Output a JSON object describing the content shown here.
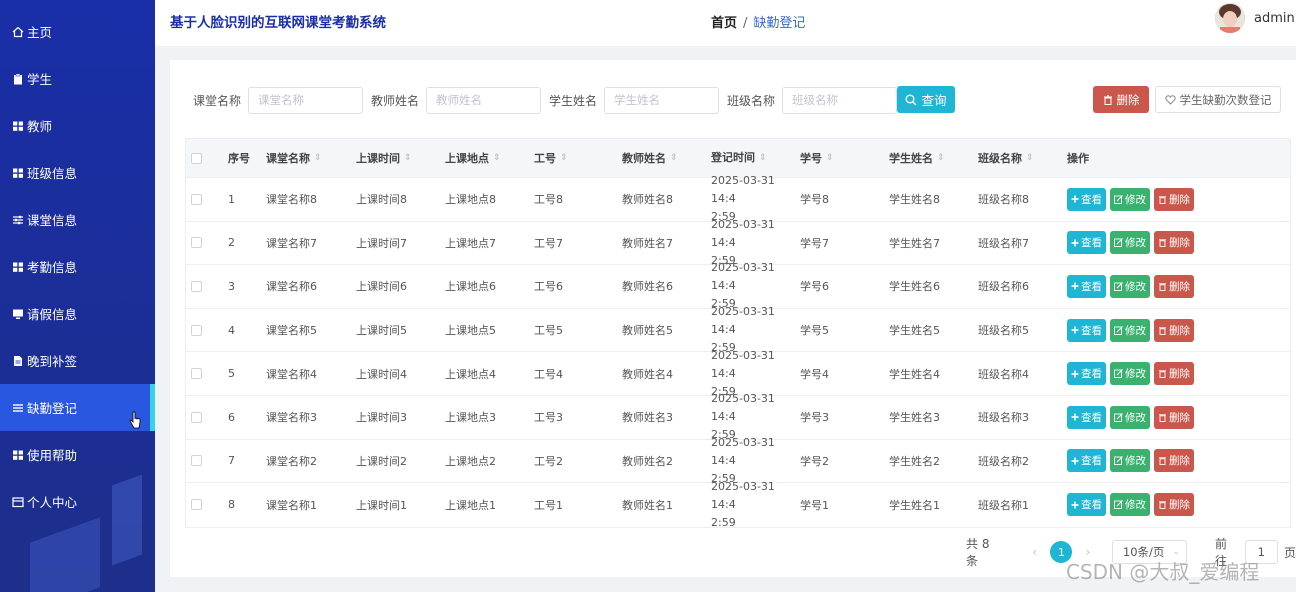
{
  "sidebar": {
    "items": [
      {
        "label": "主页",
        "icon": "home-icon"
      },
      {
        "label": "学生",
        "icon": "clipboard-icon"
      },
      {
        "label": "教师",
        "icon": "grid-icon"
      },
      {
        "label": "班级信息",
        "icon": "grid-icon"
      },
      {
        "label": "课堂信息",
        "icon": "sliders-icon"
      },
      {
        "label": "考勤信息",
        "icon": "grid-icon"
      },
      {
        "label": "请假信息",
        "icon": "monitor-icon"
      },
      {
        "label": "晚到补签",
        "icon": "document-icon"
      },
      {
        "label": "缺勤登记",
        "icon": "list-icon",
        "active": true
      },
      {
        "label": "使用帮助",
        "icon": "grid-icon"
      },
      {
        "label": "个人中心",
        "icon": "window-icon"
      }
    ],
    "active_color": "#2a57e0",
    "accent_color": "#3ad0f0"
  },
  "header": {
    "title": "基于人脸识别的互联网课堂考勤系统",
    "breadcrumb_home": "首页",
    "breadcrumb_sep": "/",
    "breadcrumb_current": "缺勤登记",
    "username": "admin"
  },
  "search": {
    "course_label": "课堂名称",
    "course_placeholder": "课堂名称",
    "teacher_label": "教师姓名",
    "teacher_placeholder": "教师姓名",
    "student_label": "学生姓名",
    "student_placeholder": "学生姓名",
    "class_label": "班级名称",
    "class_placeholder": "班级名称",
    "search_button": "查询",
    "delete_button": "删除",
    "count_button": "学生缺勤次数登记"
  },
  "table": {
    "headers": [
      "序号",
      "课堂名称",
      "上课时间",
      "上课地点",
      "工号",
      "教师姓名",
      "登记时间",
      "学号",
      "学生姓名",
      "班级名称",
      "操作"
    ],
    "rows": [
      {
        "idx": "1",
        "name": "课堂名称8",
        "time": "上课时间8",
        "place": "上课地点8",
        "gh": "工号8",
        "tname": "教师姓名8",
        "reg": "2025-03-31 14:4\n2:59",
        "xh": "学号8",
        "sname": "学生姓名8",
        "bj": "班级名称8"
      },
      {
        "idx": "2",
        "name": "课堂名称7",
        "time": "上课时间7",
        "place": "上课地点7",
        "gh": "工号7",
        "tname": "教师姓名7",
        "reg": "2025-03-31 14:4\n2:59",
        "xh": "学号7",
        "sname": "学生姓名7",
        "bj": "班级名称7"
      },
      {
        "idx": "3",
        "name": "课堂名称6",
        "time": "上课时间6",
        "place": "上课地点6",
        "gh": "工号6",
        "tname": "教师姓名6",
        "reg": "2025-03-31 14:4\n2:59",
        "xh": "学号6",
        "sname": "学生姓名6",
        "bj": "班级名称6"
      },
      {
        "idx": "4",
        "name": "课堂名称5",
        "time": "上课时间5",
        "place": "上课地点5",
        "gh": "工号5",
        "tname": "教师姓名5",
        "reg": "2025-03-31 14:4\n2:59",
        "xh": "学号5",
        "sname": "学生姓名5",
        "bj": "班级名称5"
      },
      {
        "idx": "5",
        "name": "课堂名称4",
        "time": "上课时间4",
        "place": "上课地点4",
        "gh": "工号4",
        "tname": "教师姓名4",
        "reg": "2025-03-31 14:4\n2:59",
        "xh": "学号4",
        "sname": "学生姓名4",
        "bj": "班级名称4"
      },
      {
        "idx": "6",
        "name": "课堂名称3",
        "time": "上课时间3",
        "place": "上课地点3",
        "gh": "工号3",
        "tname": "教师姓名3",
        "reg": "2025-03-31 14:4\n2:59",
        "xh": "学号3",
        "sname": "学生姓名3",
        "bj": "班级名称3"
      },
      {
        "idx": "7",
        "name": "课堂名称2",
        "time": "上课时间2",
        "place": "上课地点2",
        "gh": "工号2",
        "tname": "教师姓名2",
        "reg": "2025-03-31 14:4\n2:59",
        "xh": "学号2",
        "sname": "学生姓名2",
        "bj": "班级名称2"
      },
      {
        "idx": "8",
        "name": "课堂名称1",
        "time": "上课时间1",
        "place": "上课地点1",
        "gh": "工号1",
        "tname": "教师姓名1",
        "reg": "2025-03-31 14:4\n2:59",
        "xh": "学号1",
        "sname": "学生姓名1",
        "bj": "班级名称1"
      }
    ],
    "op_view": "查看",
    "op_edit": "修改",
    "op_delete": "删除"
  },
  "pagination": {
    "total": "共 8 条",
    "prev": "‹",
    "current_page": "1",
    "next": "›",
    "page_size": "10条/页",
    "goto_label": "前往",
    "goto_value": "1",
    "page_suffix": "页"
  },
  "watermark": "CSDN @大叔_爱编程",
  "colors": {
    "primary": "#1fb5d4",
    "success": "#3ab16f",
    "danger": "#c9574c",
    "sidebar": "#1a2ea8"
  }
}
